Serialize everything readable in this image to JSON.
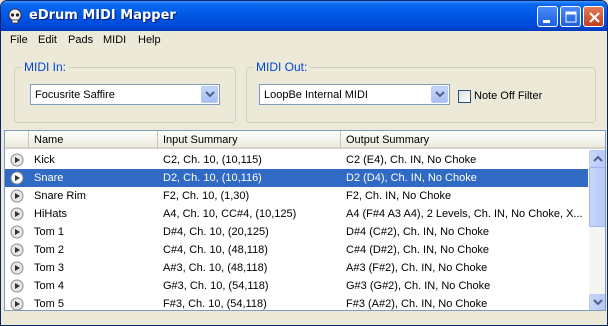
{
  "window": {
    "title": "eDrum MIDI Mapper",
    "app_icon": "skull-icon",
    "controls": [
      "minimize-icon",
      "maximize-icon",
      "close-icon"
    ]
  },
  "menu": [
    {
      "label": "File"
    },
    {
      "label": "Edit"
    },
    {
      "label": "Pads"
    },
    {
      "label": "MIDI"
    },
    {
      "label": "Help"
    }
  ],
  "midi_in": {
    "label": "MIDI In:",
    "selected": "Focusrite Saffire"
  },
  "midi_out": {
    "label": "MIDI Out:",
    "selected": "LoopBe Internal MIDI",
    "note_off_filter_label": "Note Off Filter",
    "note_off_filter_checked": false
  },
  "list": {
    "columns": [
      "Name",
      "Input Summary",
      "Output Summary"
    ],
    "selected_index": 1,
    "rows": [
      {
        "name": "Kick",
        "input": "C2, Ch. 10, (10,115)",
        "output": "C2 (E4), Ch. IN, No Choke"
      },
      {
        "name": "Snare",
        "input": "D2, Ch. 10, (10,116)",
        "output": "D2 (D4), Ch. IN, No Choke"
      },
      {
        "name": "Snare Rim",
        "input": "F2, Ch. 10, (1,30)",
        "output": "F2, Ch. IN, No Choke"
      },
      {
        "name": "HiHats",
        "input": "A4, Ch. 10, CC#4, (10,125)",
        "output": "A4 (F#4 A3 A4), 2 Levels, Ch. IN, No Choke, X..."
      },
      {
        "name": "Tom 1",
        "input": "D#4, Ch. 10, (20,125)",
        "output": "D#4 (C#2), Ch. IN, No Choke"
      },
      {
        "name": "Tom 2",
        "input": "C#4, Ch. 10, (48,118)",
        "output": "C#4 (D#2), Ch. IN, No Choke"
      },
      {
        "name": "Tom 3",
        "input": "A#3, Ch. 10, (48,118)",
        "output": "A#3 (F#2), Ch. IN, No Choke"
      },
      {
        "name": "Tom 4",
        "input": "G#3, Ch. 10, (54,118)",
        "output": "G#3 (G#2), Ch. IN, No Choke"
      },
      {
        "name": "Tom 5",
        "input": "F#3, Ch. 10, (54,118)",
        "output": "F#3 (A#2), Ch. IN, No Choke"
      }
    ]
  },
  "colors": {
    "titlebar": "#0054e3",
    "selection": "#316ac5",
    "group_label": "#0046d5"
  }
}
